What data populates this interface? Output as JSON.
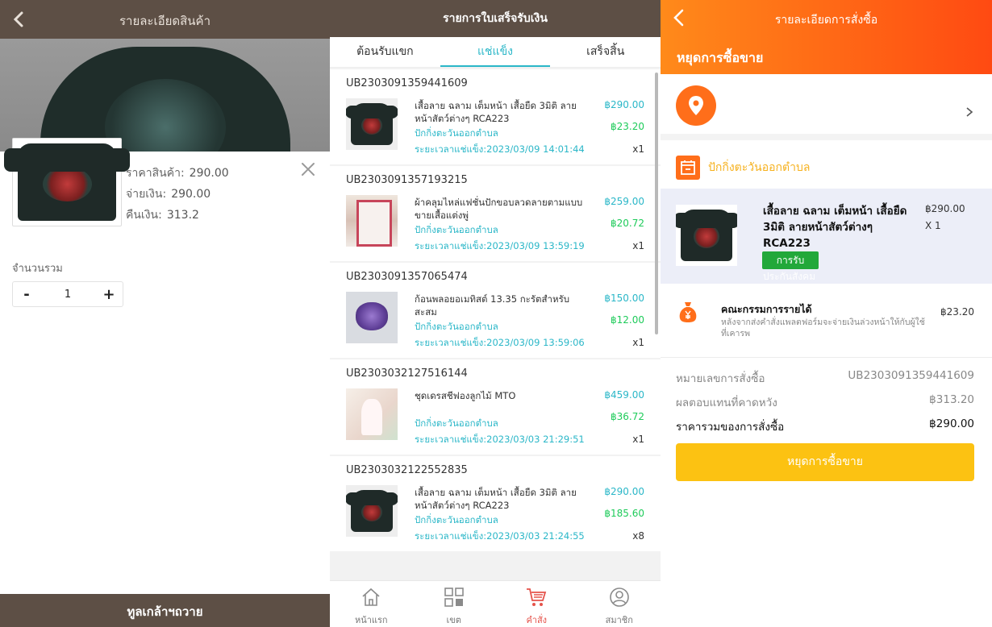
{
  "colors": {
    "header_brown": "#5d4f45",
    "accent_teal": "#2bb7c8",
    "green": "#1ecb5a",
    "orange": "#ff6e1a",
    "gold": "#fcc212"
  },
  "panel1": {
    "title": "รายละเอียดสินค้า",
    "price_label": "ราคาสินค้า:",
    "price_value": "290.00",
    "pay_label": "จ่ายเงิน:",
    "pay_value": "290.00",
    "refund_label": "คืนเงิน:",
    "refund_value": "313.2",
    "quantity_label": "จำนวนรวม",
    "minus": "-",
    "quantity": "1",
    "plus": "+",
    "footer_button": "ทูลเกล้าฯถวาย"
  },
  "panel2": {
    "title": "รายการใบเสร็จรับเงิน",
    "tabs": [
      {
        "label": "ต้อนรับแขก"
      },
      {
        "label": "แช่แข็ง"
      },
      {
        "label": "เสร็จสิ้น"
      }
    ],
    "orders": [
      {
        "id": "UB2303091359441609",
        "name": "เสื้อลาย ฉลาม เต็มหน้า เสื้อยืด 3มิติ ลายหน้าสัตว์ต่างๆ RCA223",
        "category": "ปักกิ่งตะวันออกตำบล",
        "time": "ระยะเวลาแช่แข็ง:2023/03/09 14:01:44",
        "price": "฿290.00",
        "commission": "฿23.20",
        "qty": "x1",
        "image": "tshirt"
      },
      {
        "id": "UB2303091357193215",
        "name": "ผ้าคลุมไหล่แฟชั่นปักขอบลวดลายตามแบบ ขายเสื้อแต่งพู่",
        "category": "ปักกิ่งตะวันออกตำบล",
        "time": "ระยะเวลาแช่แข็ง:2023/03/09 13:59:19",
        "price": "฿259.00",
        "commission": "฿20.72",
        "qty": "x1",
        "image": "shawl"
      },
      {
        "id": "UB2303091357065474",
        "name": "ก้อนพลอยอเมทิสต์ 13.35 กะรัตสำหรับสะสม",
        "category": "ปักกิ่งตะวันออกตำบล",
        "time": "ระยะเวลาแช่แข็ง:2023/03/09 13:59:06",
        "price": "฿150.00",
        "commission": "฿12.00",
        "qty": "x1",
        "image": "crystal"
      },
      {
        "id": "UB2303032127516144",
        "name": "ชุดเดรสชีฟองลูกไม้ MTO",
        "category": "ปักกิ่งตะวันออกตำบล",
        "time": "ระยะเวลาแช่แข็ง:2023/03/03 21:29:51",
        "price": "฿459.00",
        "commission": "฿36.72",
        "qty": "x1",
        "image": "dress"
      },
      {
        "id": "UB2303032122552835",
        "name": "เสื้อลาย ฉลาม เต็มหน้า เสื้อยืด 3มิติ ลายหน้าสัตว์ต่างๆ RCA223",
        "category": "ปักกิ่งตะวันออกตำบล",
        "time": "ระยะเวลาแช่แข็ง:2023/03/03 21:24:55",
        "price": "฿290.00",
        "commission": "฿185.60",
        "qty": "x8",
        "image": "tshirt"
      }
    ],
    "nav": [
      {
        "label": "หน้าแรก",
        "icon": "home-icon"
      },
      {
        "label": "เขต",
        "icon": "grid-icon"
      },
      {
        "label": "คำสั่ง",
        "icon": "cart-icon"
      },
      {
        "label": "สมาชิก",
        "icon": "user-icon"
      }
    ]
  },
  "panel3": {
    "title": "รายละเอียดการสั่งซื้อ",
    "subtitle": "หยุดการซื้อขาย",
    "shop_name": "ปักกิ่งตะวันออกตำบล",
    "product_name": "เสื้อลาย ฉลาม เต็มหน้า เสื้อยืด 3มิติ ลายหน้าสัตว์ต่างๆ RCA223",
    "product_price": "฿290.00",
    "product_qty": "X 1",
    "badge": "การรับ",
    "badge_sub": "ประกันสังคม",
    "commission_title": "คณะกรรมการรายได้",
    "commission_desc": "หลังจากส่งคำสั่งแพลตฟอร์มจะจ่ายเงินล่วงหน้าให้กับผู้ใช้ที่เคารพ",
    "commission_value": "฿23.20",
    "order_no_label": "หมายเลขการสั่งซื้อ",
    "order_no_value": "UB2303091359441609",
    "expected_label": "ผลตอบแทนที่คาดหวัง",
    "expected_value": "฿313.20",
    "total_label": "ราคารวมของการสั่งซื้อ",
    "total_value": "฿290.00",
    "cta": "หยุดการซื้อขาย"
  }
}
